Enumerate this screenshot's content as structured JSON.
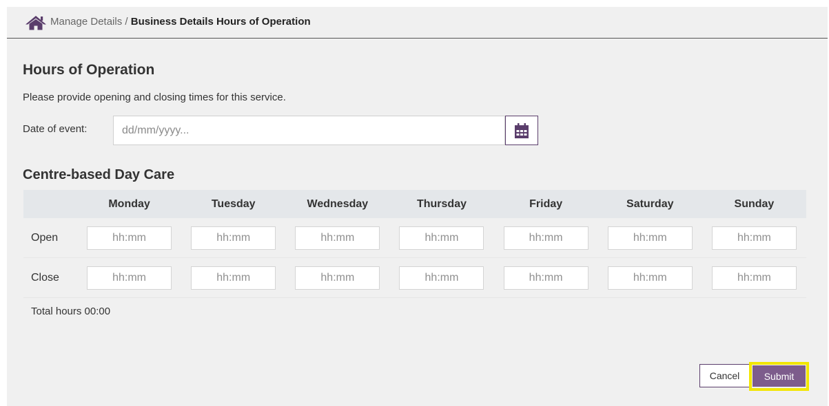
{
  "colors": {
    "brand": "#5a3d6b",
    "submit_bg": "#7d5c8c",
    "highlight": "#f2e600",
    "table_header_bg": "#e4e7ea"
  },
  "breadcrumb": {
    "icon": "home-icon",
    "parent": "Manage Details",
    "separator": " / ",
    "current": "Business Details Hours of Operation"
  },
  "page": {
    "title": "Hours of Operation",
    "intro": "Please provide opening and closing times for this service."
  },
  "date_field": {
    "label": "Date of event:",
    "placeholder": "dd/mm/yyyy...",
    "value": "",
    "button_icon": "calendar-icon"
  },
  "section": {
    "title": "Centre-based Day Care"
  },
  "table": {
    "days": [
      "Monday",
      "Tuesday",
      "Wednesday",
      "Thursday",
      "Friday",
      "Saturday",
      "Sunday"
    ],
    "rows": [
      {
        "label": "Open",
        "placeholder": "hh:mm",
        "values": [
          "",
          "",
          "",
          "",
          "",
          "",
          ""
        ]
      },
      {
        "label": "Close",
        "placeholder": "hh:mm",
        "values": [
          "",
          "",
          "",
          "",
          "",
          "",
          ""
        ]
      }
    ]
  },
  "total": {
    "label": "Total hours",
    "value": "00:00",
    "text": "Total hours 00:00"
  },
  "actions": {
    "cancel": "Cancel",
    "submit": "Submit"
  }
}
